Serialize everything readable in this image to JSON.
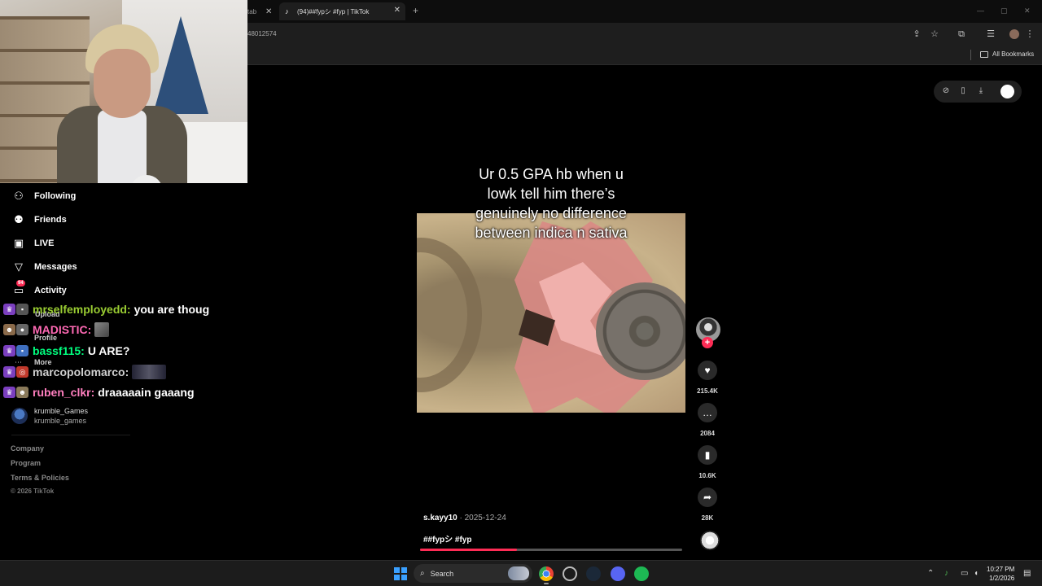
{
  "browser": {
    "prev_tab_title": "tab",
    "active_tab_title": "(94)##fypシ #fyp | TikTok",
    "url": "48012574",
    "bookmarks_label": "All Bookmarks",
    "icons": [
      "tiktok-favicon-icon",
      "close-icon",
      "plus-icon",
      "minimize-icon",
      "maximize-icon",
      "cast-icon",
      "star-icon",
      "extensions-icon",
      "media-icon",
      "menu-icon",
      "folder-icon"
    ]
  },
  "sidebar": {
    "items": [
      {
        "label": "Following",
        "icon": "following-icon"
      },
      {
        "label": "Friends",
        "icon": "friends-icon"
      },
      {
        "label": "LIVE",
        "icon": "live-icon"
      },
      {
        "label": "Messages",
        "icon": "messages-icon"
      },
      {
        "label": "Activity",
        "icon": "activity-icon",
        "badge": "94"
      }
    ],
    "ghost_items": [
      "Upload",
      "Profile",
      "More"
    ],
    "account": {
      "name": "krumble_Games",
      "handle": "krumble_games"
    },
    "footer_links": [
      "Company",
      "Program",
      "Terms & Policies"
    ],
    "copyright": "© 2026 TikTok"
  },
  "chat": {
    "messages": [
      {
        "user": "mrselfemployedd:",
        "color": "#9acd32",
        "text": "you are thoug"
      },
      {
        "user": "MADISTIC:",
        "color": "#ff69b4",
        "text": ""
      },
      {
        "user": "bassf115:",
        "color": "#00ff7f",
        "text": "U ARE?"
      },
      {
        "user": "marcopolomarco:",
        "color": "#d0d0d0",
        "text": ""
      },
      {
        "user": "ruben_clkr:",
        "color": "#ff7fbf",
        "text": "draaaaain gaaang"
      }
    ]
  },
  "video": {
    "caption_lines": [
      "Ur 0.5 GPA hb when u",
      "lowk tell him there’s",
      "genuinely no difference",
      "between indica n sativa"
    ],
    "author": "s.kayy10",
    "date": "2025-12-24",
    "tags": "##fypシ #fyp",
    "progress_fraction": 0.37,
    "accent_color": "#fe2c55"
  },
  "actions": {
    "likes": "215.4K",
    "comments": "2084",
    "bookmarks": "10.6K",
    "shares": "28K"
  },
  "taskbar": {
    "search_label": "Search",
    "time": "10:27 PM",
    "date": "1/2/2026"
  }
}
